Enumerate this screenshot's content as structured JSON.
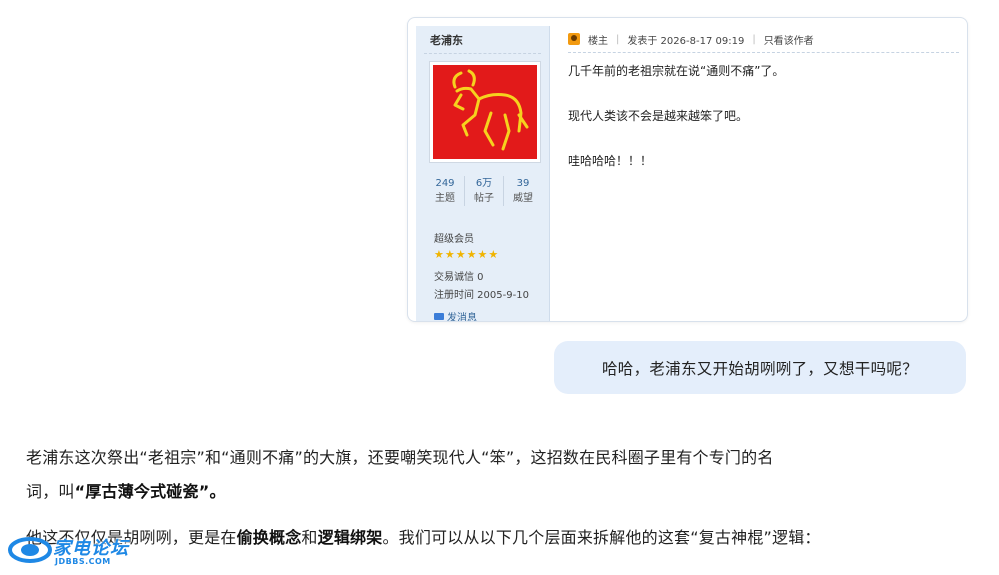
{
  "post": {
    "username": "老浦东",
    "stats": [
      {
        "num": "249",
        "label": "主题"
      },
      {
        "num": "6万",
        "label": "帖子"
      },
      {
        "num": "39",
        "label": "威望"
      }
    ],
    "group": "超级会员",
    "star_count": 6,
    "trade_credit": "交易诚信 0",
    "register": "注册时间 2005-9-10",
    "send_message": "发消息",
    "header": {
      "owner": "楼主",
      "posted": "发表于 2026-8-17 09:19",
      "only_author": "只看该作者"
    },
    "lines": [
      "几千年前的老祖宗就在说“通则不痛”了。",
      "现代人类该不会是越来越笨了吧。",
      "哇哈哈哈！！！"
    ]
  },
  "bubble": {
    "text": "哈哈，老浦东又开始胡咧咧了，又想干吗呢？"
  },
  "answer": {
    "p1_line1": "老浦东这次祭出“老祖宗”和“通则不痛”的大旗，还要嘲笑现代人“笨”，这招数在民科圈子里有个专门的名",
    "p1_line2_prefix": "词，叫",
    "p1_line2_bold": "“厚古薄今式碰瓷”",
    "p1_line2_suffix": "。",
    "p2_prefix": "他这不仅仅是胡咧咧，更是在",
    "p2_bold1": "偷换概念",
    "p2_mid": "和",
    "p2_bold2": "逻辑绑架",
    "p2_suffix": "。我们可以从以下几个层面来拆解他的这套“复古神棍”逻辑："
  },
  "watermark": {
    "title": "家电论坛",
    "url": "JDBBS.COM"
  },
  "colors": {
    "avatar_bg": "#e21a1a",
    "avatar_fg": "#f6d21e",
    "bubble_bg": "#e4eefb",
    "link": "#336699",
    "watermark": "#1e88e5"
  }
}
